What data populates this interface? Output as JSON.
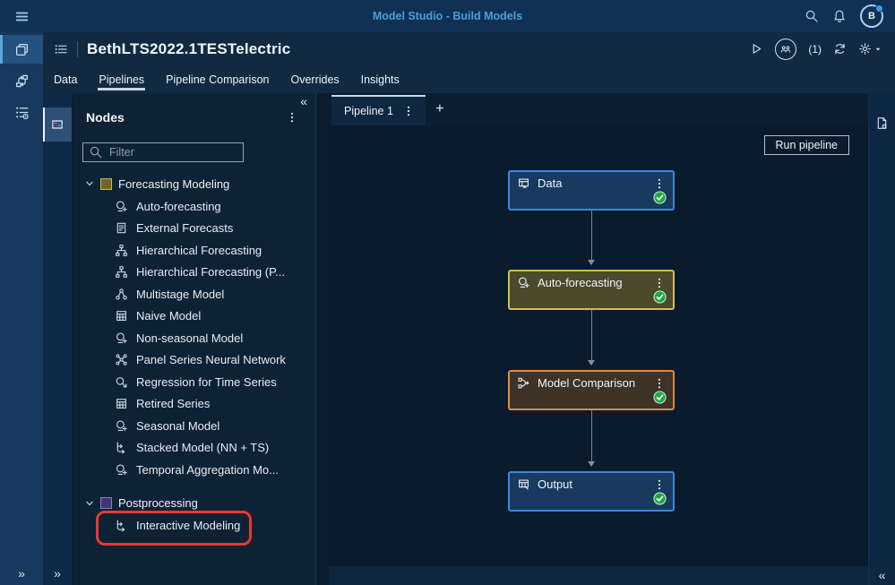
{
  "glyphs": {
    "collapse": "«",
    "expand": "»",
    "add": "+"
  },
  "colors": {
    "accent_blue": "#4f9dd9",
    "highlight_red": "#e7392e",
    "status_green": "#1ea83c",
    "node_blue_border": "#3a87e0",
    "node_yellow_border": "#cfbd57",
    "node_orange_border": "#df8b42"
  },
  "topbar": {
    "title": "Model Studio - Build Models",
    "avatar_initial": "B"
  },
  "header": {
    "project_title": "BethLTS2022.1TESTelectric",
    "session_count": "(1)"
  },
  "tabs": [
    {
      "label": "Data",
      "active": false
    },
    {
      "label": "Pipelines",
      "active": true
    },
    {
      "label": "Pipeline Comparison",
      "active": false
    },
    {
      "label": "Overrides",
      "active": false
    },
    {
      "label": "Insights",
      "active": false
    }
  ],
  "left_rail": {
    "items": [
      {
        "icon": "stacked-pages",
        "active": true
      },
      {
        "icon": "branch-arrows",
        "active": false
      },
      {
        "icon": "list-settings",
        "active": false
      }
    ]
  },
  "nodes_panel": {
    "title": "Nodes",
    "filter_placeholder": "Filter",
    "groups": [
      {
        "label": "Forecasting Modeling",
        "chip_fill": "#6f6527",
        "chip_border": "#c8bb55",
        "items": [
          {
            "label": "Auto-forecasting",
            "icon": "crystal-ball"
          },
          {
            "label": "External Forecasts",
            "icon": "document"
          },
          {
            "label": "Hierarchical Forecasting",
            "icon": "hierarchy"
          },
          {
            "label": "Hierarchical Forecasting (P...",
            "icon": "hierarchy"
          },
          {
            "label": "Multistage Model",
            "icon": "multistage"
          },
          {
            "label": "Naive Model",
            "icon": "grid-table"
          },
          {
            "label": "Non-seasonal Model",
            "icon": "crystal-ball"
          },
          {
            "label": "Panel Series Neural Network",
            "icon": "neural-network"
          },
          {
            "label": "Regression for Time Series",
            "icon": "regression"
          },
          {
            "label": "Retired Series",
            "icon": "grid-table"
          },
          {
            "label": "Seasonal Model",
            "icon": "crystal-ball"
          },
          {
            "label": "Stacked Model (NN + TS)",
            "icon": "stacked-flow"
          },
          {
            "label": "Temporal Aggregation Mo...",
            "icon": "crystal-ball"
          }
        ]
      },
      {
        "label": "Postprocessing",
        "chip_fill": "#3a3a6e",
        "chip_border": "#7d7dd0",
        "items": [
          {
            "label": "Interactive Modeling",
            "icon": "stacked-flow",
            "highlighted": true
          }
        ]
      }
    ]
  },
  "pipeline": {
    "tab_label": "Pipeline 1",
    "run_label": "Run pipeline",
    "nodes": [
      {
        "label": "Data",
        "icon": "data-table",
        "border": "#3a87e0",
        "fill": "#173a5e",
        "status": "success"
      },
      {
        "label": "Auto-forecasting",
        "icon": "crystal-ball",
        "border": "#cfbd57",
        "fill": "#4b4a2c",
        "status": "success"
      },
      {
        "label": "Model Comparison",
        "icon": "model-compare",
        "border": "#df8b42",
        "fill": "#3f3226",
        "status": "success"
      },
      {
        "label": "Output",
        "icon": "output-table",
        "border": "#3a87e0",
        "fill": "#173a5e",
        "status": "success"
      }
    ]
  }
}
